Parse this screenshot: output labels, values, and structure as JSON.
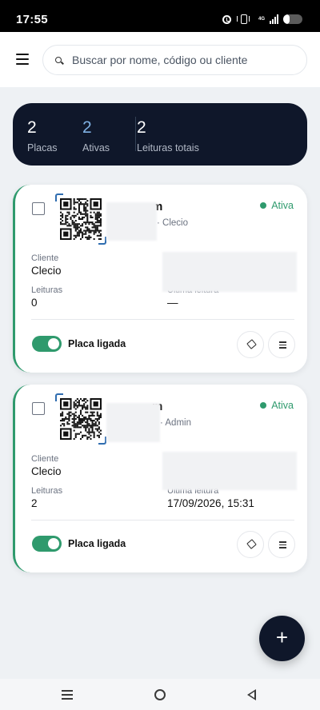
{
  "status_bar": {
    "time": "17:55",
    "network": "4G",
    "battery_level": 0.35
  },
  "search": {
    "placeholder": "Buscar por nome, código ou cliente"
  },
  "stats": [
    {
      "value": "2",
      "label": "Placas"
    },
    {
      "value": "2",
      "label": "Ativas"
    },
    {
      "value": "2",
      "label": "Leituras totais"
    }
  ],
  "cards": [
    {
      "title": "m",
      "subtitle": "· Clecio",
      "status": "Ativa",
      "client_label": "Cliente",
      "client": "Clecio",
      "reads_label": "Leituras",
      "reads": "0",
      "last_read_label": "Última leitura",
      "last_read": "—",
      "toggle_label": "Placa ligada",
      "toggle_on": true
    },
    {
      "title": "m",
      "subtitle": "· Admin",
      "status": "Ativa",
      "client_label": "Cliente",
      "client": "Clecio",
      "reads_label": "Leituras",
      "reads": "2",
      "last_read_label": "Última leitura",
      "last_read": "17/09/2026, 15:31",
      "toggle_label": "Placa ligada",
      "toggle_on": true
    }
  ],
  "fab": {
    "label": "+"
  },
  "colors": {
    "accent": "#2f9a6d",
    "dark": "#0f172a",
    "active_stat": "#7fb1e3"
  },
  "icons": {
    "menu": "hamburger-icon",
    "search": "search-icon",
    "edit": "edit-icon",
    "more": "grid-icon",
    "add": "plus-icon"
  }
}
